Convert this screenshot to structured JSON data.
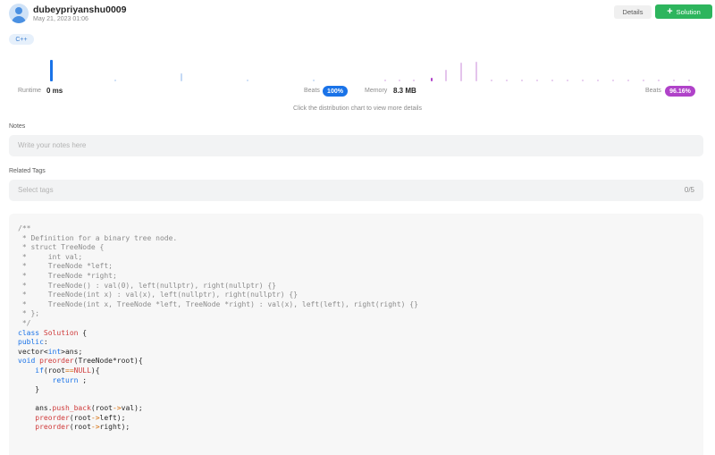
{
  "header": {
    "username": "dubeypriyanshu0009",
    "date": "May 21, 2023 01:06",
    "details_label": "Details",
    "solution_label": "Solution"
  },
  "language": "C++",
  "stats": {
    "runtime_label": "Runtime",
    "runtime_value": "0 ms",
    "runtime_beats_label": "Beats",
    "runtime_beats": "100%",
    "memory_label": "Memory",
    "memory_value": "8.3 MB",
    "memory_beats_label": "Beats",
    "memory_beats": "96.16%"
  },
  "distribution_hint": "Click the distribution chart to view more details",
  "notes": {
    "label": "Notes",
    "placeholder": "Write your notes here"
  },
  "tags": {
    "label": "Related Tags",
    "placeholder": "Select tags",
    "count": "0/5"
  },
  "colors": {
    "accent_blue": "#1a73e8",
    "accent_purple": "#b042c9",
    "solution_green": "#2db55d"
  },
  "icons": {
    "avatar": "user-avatar-icon",
    "plus": "plus-icon"
  }
}
